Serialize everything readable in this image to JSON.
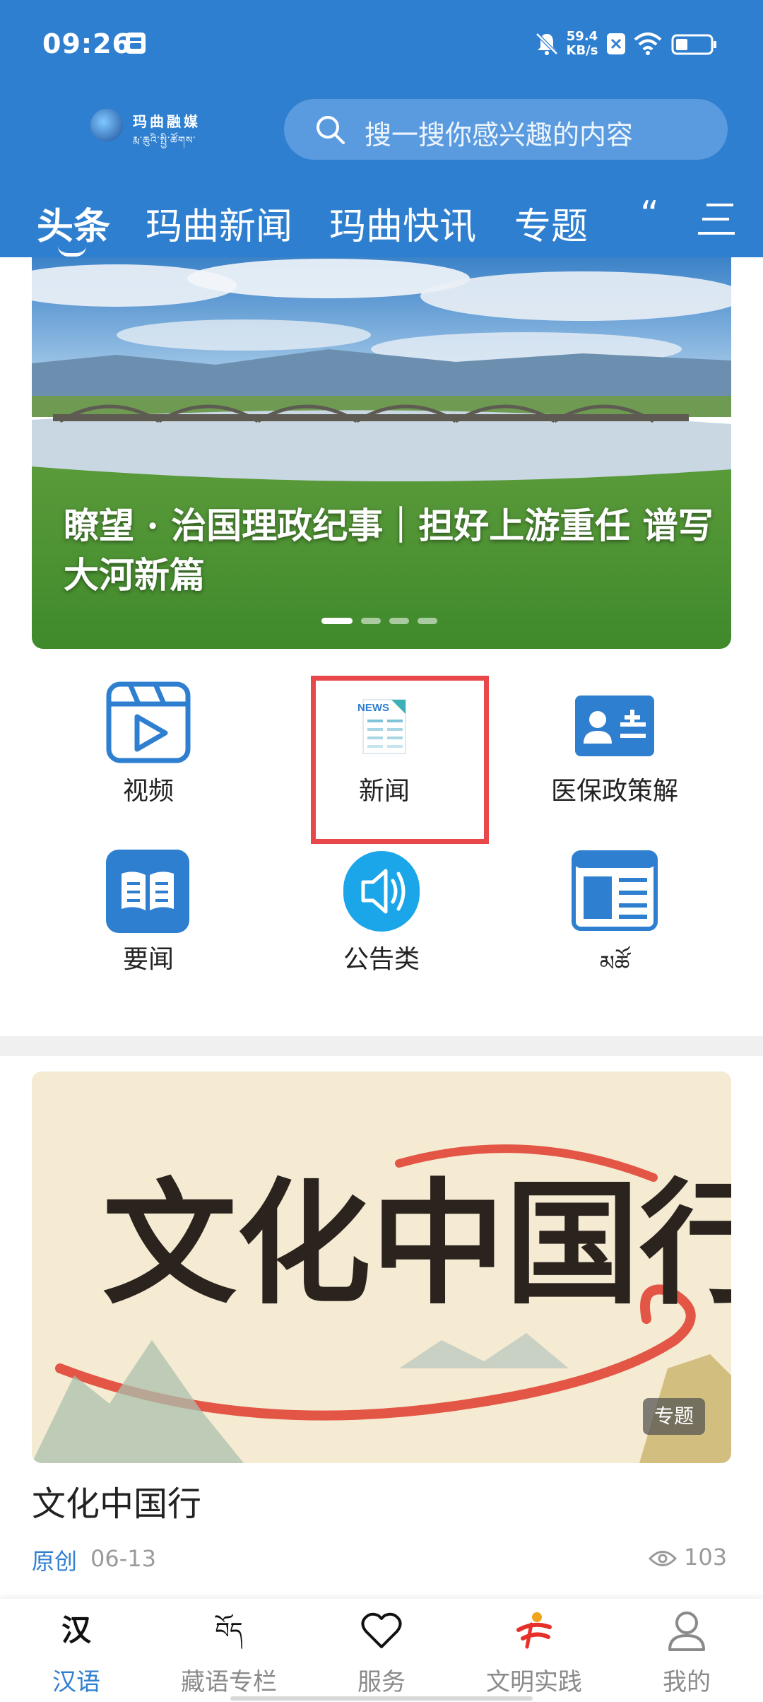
{
  "status_bar": {
    "time": "09:26",
    "net_speed_value": "59.4",
    "net_speed_unit": "KB/s"
  },
  "header": {
    "logo_text": "玛曲融媒",
    "logo_subtext": "རྨ་ཆུའི་སྤྱི་ཚོགས་",
    "search_placeholder": "搜一搜你感兴趣的内容",
    "tabs": [
      {
        "label": "头条",
        "active": true
      },
      {
        "label": "玛曲新闻",
        "active": false
      },
      {
        "label": "玛曲快讯",
        "active": false
      },
      {
        "label": "专题",
        "active": false
      }
    ],
    "more_tabs_glyph": "“"
  },
  "banner": {
    "caption": "瞭望 · 治国理政纪事｜担好上游重任 谱写大河新篇",
    "slide_count": 4,
    "active_slide": 1
  },
  "grid": {
    "items": [
      {
        "label": "视频",
        "icon": "video-icon"
      },
      {
        "label": "新闻",
        "icon": "news-icon",
        "icon_text": "NEWS"
      },
      {
        "label": "医保政策解",
        "icon": "contact-card-icon"
      },
      {
        "label": "要闻",
        "icon": "book-icon"
      },
      {
        "label": "公告类",
        "icon": "speaker-icon"
      },
      {
        "label": "མཚོ",
        "icon": "newspaper-icon"
      }
    ]
  },
  "article": {
    "image_text": "文化中国行",
    "badge": "专题",
    "title": "文化中国行",
    "source": "原创",
    "date": "06-13",
    "views": "103"
  },
  "bottom_nav": {
    "items": [
      {
        "label": "汉语",
        "glyph": "汉",
        "active": true
      },
      {
        "label": "藏语专栏",
        "glyph": "བོད",
        "active": false
      },
      {
        "label": "服务",
        "glyph": "",
        "active": false
      },
      {
        "label": "文明实践",
        "glyph": "",
        "active": false
      },
      {
        "label": "我的",
        "glyph": "",
        "active": false
      }
    ]
  },
  "colors": {
    "brand_blue": "#2f7fd0",
    "highlight_red": "#e8484a",
    "icon_blue": "#2f7fd0",
    "speaker_cyan": "#1aa6e8"
  }
}
